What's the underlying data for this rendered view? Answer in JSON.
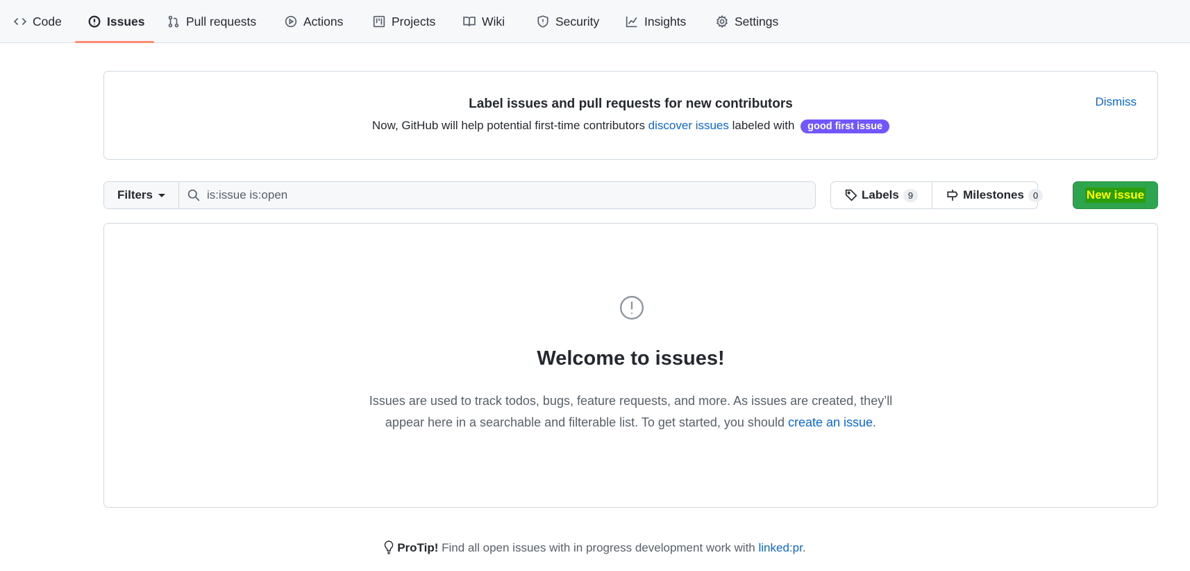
{
  "nav": {
    "tabs": [
      {
        "label": "Code",
        "icon": "code-icon"
      },
      {
        "label": "Issues",
        "icon": "issue-icon",
        "active": true
      },
      {
        "label": "Pull requests",
        "icon": "pull-request-icon"
      },
      {
        "label": "Actions",
        "icon": "play-icon"
      },
      {
        "label": "Projects",
        "icon": "project-icon"
      },
      {
        "label": "Wiki",
        "icon": "book-icon"
      },
      {
        "label": "Security",
        "icon": "shield-icon"
      },
      {
        "label": "Insights",
        "icon": "graph-icon"
      },
      {
        "label": "Settings",
        "icon": "gear-icon"
      }
    ],
    "accent": "#fd8c73"
  },
  "banner": {
    "title": "Label issues and pull requests for new contributors",
    "text_before": "Now, GitHub will help potential first-time contributors ",
    "link": "discover issues",
    "text_after": " labeled with ",
    "label": "good first issue",
    "label_color": "#7057ff",
    "dismiss": "Dismiss"
  },
  "toolbar": {
    "filters": "Filters",
    "search_value": "is:issue is:open",
    "labels": "Labels",
    "labels_count": "9",
    "milestones": "Milestones",
    "milestones_count": "0",
    "new_issue": "New issue",
    "new_issue_color": "#2da44e"
  },
  "blankslate": {
    "title": "Welcome to issues!",
    "line1": "Issues are used to track todos, bugs, feature requests, and more. As issues are created, they’ll",
    "line2": "appear here in a searchable and filterable list. To get started, you should ",
    "link": "create an issue",
    "end": "."
  },
  "protip": {
    "label": "ProTip!",
    "text": " Find all open issues with in progress development work with ",
    "link": "linked:pr",
    "end": "."
  }
}
